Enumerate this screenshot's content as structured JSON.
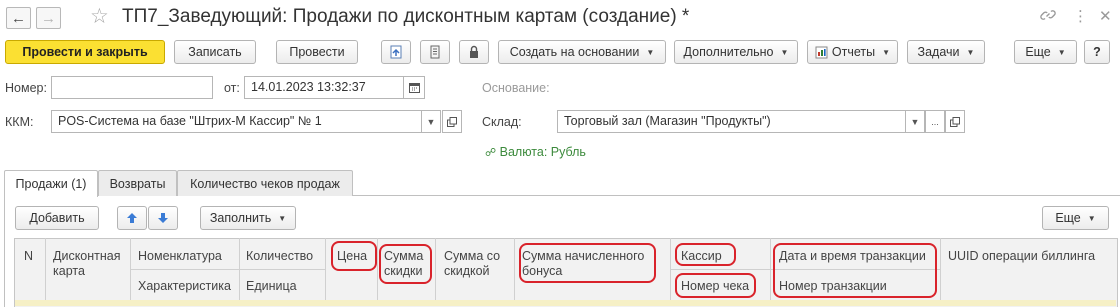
{
  "window": {
    "title": "ТП7_Заведующий: Продажи по дисконтным картам (создание) *",
    "back_icon": "arrow-left-icon",
    "forward_icon": "arrow-right-icon",
    "favorite_icon": "star-icon",
    "link_icon": "link-icon",
    "more_icon": "kebab-icon",
    "close_icon": "close-icon"
  },
  "toolbar": {
    "post_close": "Провести и закрыть",
    "save": "Записать",
    "post": "Провести",
    "create_based": "Создать на основании",
    "additional": "Дополнительно",
    "reports": "Отчеты",
    "tasks": "Задачи",
    "more": "Еще",
    "help": "?"
  },
  "form": {
    "number_label": "Номер:",
    "number_value": "",
    "date_label": "от:",
    "date_value": "14.01.2023 13:32:37",
    "basis_label": "Основание:",
    "kkm_label": "ККМ:",
    "kkm_value": "POS-Система на базе \"Штрих-М Кассир\" № 1",
    "warehouse_label": "Склад:",
    "warehouse_value": "Торговый зал (Магазин \"Продукты\")",
    "currency_text": "Валюта: Рубль",
    "ellipsis": "..."
  },
  "tabs": [
    {
      "label": "Продажи (1)",
      "active": true
    },
    {
      "label": "Возвраты",
      "active": false
    },
    {
      "label": "Количество чеков продаж",
      "active": false
    }
  ],
  "table_toolbar": {
    "add": "Добавить",
    "fill": "Заполнить",
    "more": "Еще"
  },
  "table": {
    "headers": {
      "n": "N",
      "card": "Дисконтная карта",
      "nomenclature": "Номенклатура",
      "characteristic": "Характеристика",
      "quantity": "Количество",
      "unit": "Единица",
      "price": "Цена",
      "discount_sum": "Сумма скидки",
      "sum_with_discount": "Сумма со скидкой",
      "bonus_sum": "Сумма начисленного бонуса",
      "cashier": "Кассир",
      "receipt_number": "Номер чека",
      "transaction_datetime": "Дата и время транзакции",
      "transaction_number": "Номер транзакции",
      "billing_uuid": "UUID операции биллинга"
    }
  },
  "colors": {
    "primary_button": "#fbe032",
    "highlight_outline": "#d9232b",
    "currency_link": "#3c8a3c",
    "header_bg": "#f2f2f2"
  }
}
